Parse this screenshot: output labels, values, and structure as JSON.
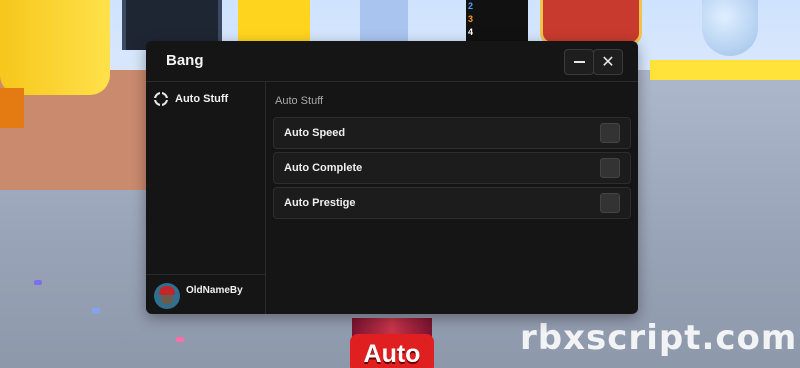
{
  "window": {
    "title": "Bang",
    "minimize_icon": "minimize-icon",
    "close_icon": "close-icon"
  },
  "sidebar": {
    "items": [
      {
        "label": "Auto Stuff",
        "icon": "crosshair-icon",
        "selected": true
      }
    ],
    "user": {
      "name": "OldNameBy",
      "avatar": "avatar-icon"
    }
  },
  "content": {
    "section_title": "Auto Stuff",
    "toggles": [
      {
        "label": "Auto Speed",
        "checked": false
      },
      {
        "label": "Auto Complete",
        "checked": false
      },
      {
        "label": "Auto Prestige",
        "checked": false
      }
    ]
  },
  "game": {
    "auto_button_label": "Auto",
    "leaderboard_ranks": [
      "2",
      "3",
      "4"
    ]
  },
  "watermark": "rbxscript.com",
  "colors": {
    "window_bg": "#151515",
    "row_bg": "#1c1c1c",
    "checkbox_bg": "#333333",
    "text": "#f0f0f0",
    "muted_text": "#a9a9a9"
  }
}
